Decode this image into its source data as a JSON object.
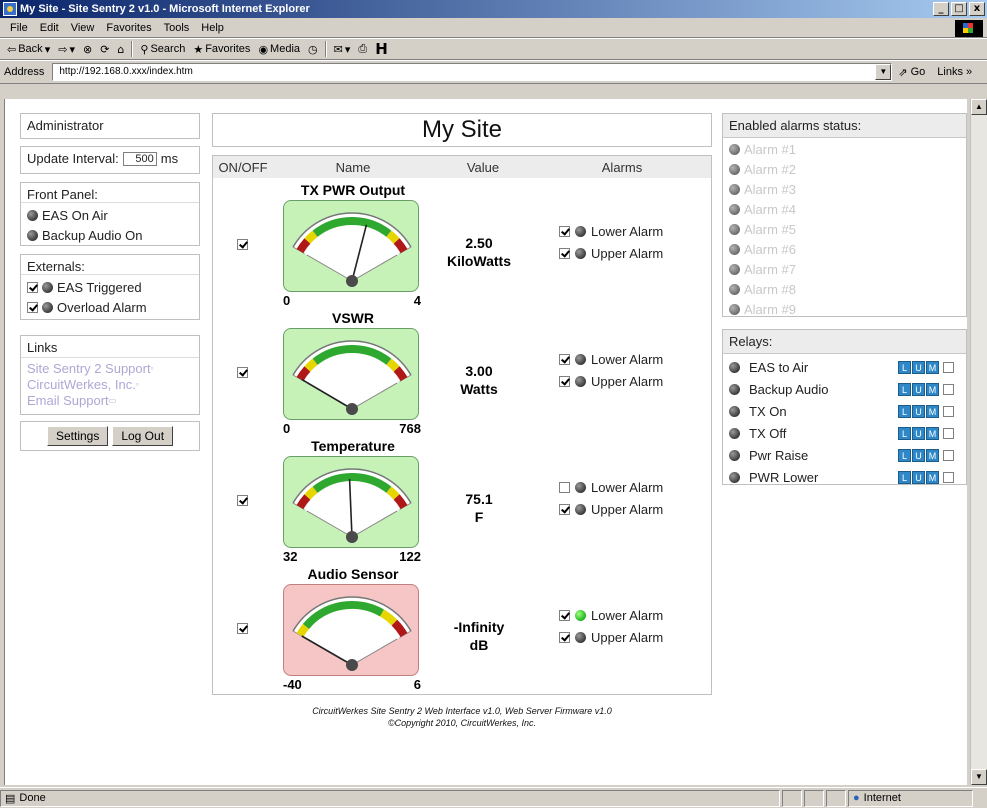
{
  "window": {
    "title": "My Site - Site Sentry 2 v1.0 - Microsoft Internet Explorer",
    "min": "_",
    "max": "□",
    "close": "x"
  },
  "menu": [
    "File",
    "Edit",
    "View",
    "Favorites",
    "Tools",
    "Help"
  ],
  "toolbar": {
    "back": "Back",
    "search": "Search",
    "favorites": "Favorites",
    "media": "Media"
  },
  "address": {
    "label": "Address",
    "url": "http://192.168.0.xxx/index.htm",
    "go": "Go",
    "links": "Links »"
  },
  "status": {
    "text": "Done",
    "zone": "Internet"
  },
  "left": {
    "user": "Administrator",
    "update_label": "Update Interval:",
    "update_value": "500",
    "update_unit": "ms",
    "front_panel": {
      "title": "Front Panel:",
      "items": [
        "EAS On Air",
        "Backup Audio On"
      ]
    },
    "externals": {
      "title": "Externals:",
      "items": [
        "EAS Triggered",
        "Overload Alarm"
      ]
    },
    "links": {
      "title": "Links",
      "items": [
        "Site Sentry 2 Support",
        "CircuitWerkes, Inc.",
        "Email Support"
      ]
    },
    "settings": "Settings",
    "logout": "Log Out"
  },
  "main": {
    "title": "My Site",
    "headers": [
      "ON/OFF",
      "Name",
      "Value",
      "Alarms"
    ],
    "meters": [
      {
        "name": "TX PWR Output",
        "min": "0",
        "max": "4",
        "value": "2.50",
        "unit": "KiloWatts",
        "level": 0.62,
        "gauge": "green",
        "lower_checked": true,
        "upper_checked": true,
        "lower_active": false
      },
      {
        "name": "VSWR",
        "min": "0",
        "max": "768",
        "value": "3.00",
        "unit": "Watts",
        "level": 0.004,
        "gauge": "green",
        "lower_checked": true,
        "upper_checked": true,
        "lower_active": false
      },
      {
        "name": "Temperature",
        "min": "32",
        "max": "122",
        "value": "75.1",
        "unit": "F",
        "level": 0.48,
        "gauge": "green",
        "lower_checked": false,
        "upper_checked": true,
        "lower_active": false
      },
      {
        "name": "Audio Sensor",
        "min": "-40",
        "max": "6",
        "value": "-Infinity",
        "unit": "dB",
        "level": 0.0,
        "gauge": "red",
        "lower_checked": true,
        "upper_checked": true,
        "lower_active": true
      }
    ],
    "lower_alarm": "Lower Alarm",
    "upper_alarm": "Upper Alarm"
  },
  "footer": {
    "line1": "CircuitWerkes Site Sentry 2 Web Interface v1.0, Web Server Firmware v1.0",
    "line2": "©Copyright 2010, CircuitWerkes, Inc."
  },
  "right": {
    "alarms_title": "Enabled alarms status:",
    "alarms": [
      "Alarm #1",
      "Alarm #2",
      "Alarm #3",
      "Alarm #4",
      "Alarm #5",
      "Alarm #6",
      "Alarm #7",
      "Alarm #8",
      "Alarm #9"
    ],
    "relays_title": "Relays:",
    "relays": [
      "EAS to Air",
      "Backup Audio",
      "TX On",
      "TX Off",
      "Pwr Raise",
      "PWR Lower"
    ],
    "relay_buttons": [
      "L",
      "U",
      "M"
    ]
  },
  "colors": {
    "gauge_green": "#c6f2b8",
    "gauge_red": "#f6c5c5",
    "link": "#b0a6d4",
    "alarm_text": "#c8c8c8",
    "relay_button": "#2e88c8"
  }
}
